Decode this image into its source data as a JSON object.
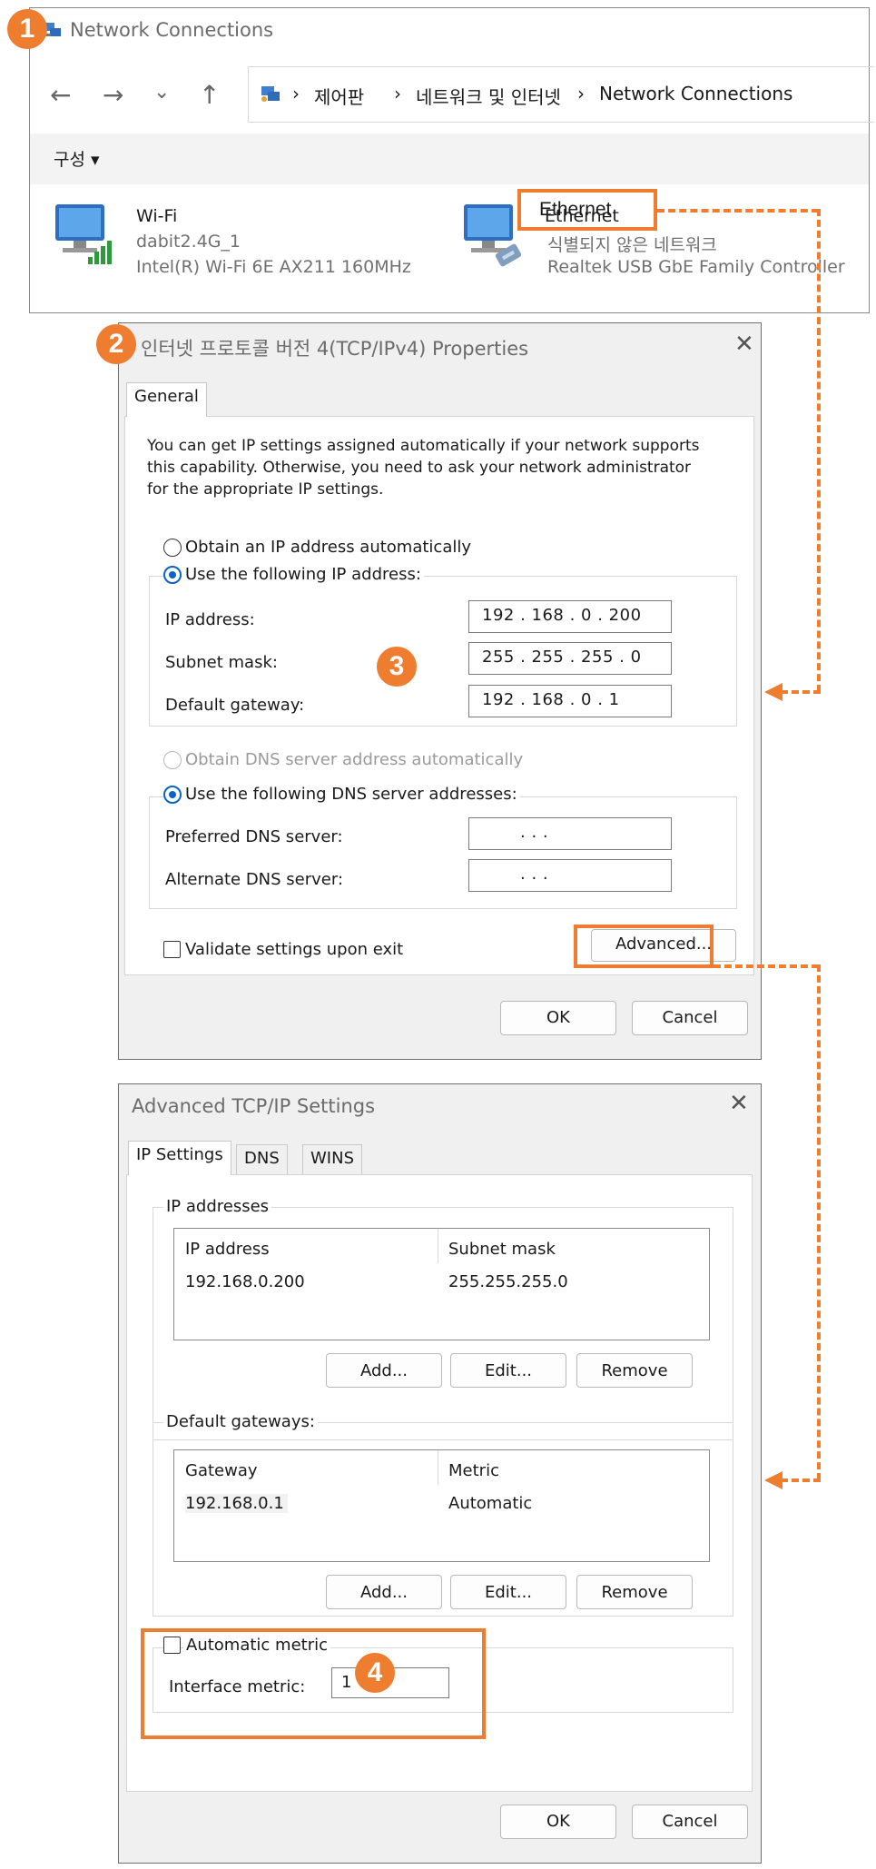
{
  "network_window": {
    "title": "Network Connections",
    "breadcrumb": [
      "제어판",
      "네트워크 및 인터넷",
      "Network Connections"
    ],
    "organize_label": "구성 ▾",
    "adapters": [
      {
        "name": "Wi-Fi",
        "network": "dabit2.4G_1",
        "device": "Intel(R) Wi-Fi 6E AX211 160MHz",
        "icon": "wifi-adapter-icon"
      },
      {
        "name": "Ethernet",
        "network": "식별되지 않은 네트워크",
        "device": "Realtek USB GbE Family Controller",
        "icon": "ethernet-adapter-icon"
      }
    ]
  },
  "ipv4_dialog": {
    "title": "인터넷 프로토콜 버전 4(TCP/IPv4) Properties",
    "tab_general": "General",
    "description": "You can get IP settings assigned automatically if your network supports this capability. Otherwise, you need to ask your network administrator for the appropriate IP settings.",
    "desc_lines": [
      "You can get IP settings assigned automatically if your network supports",
      "this capability. Otherwise, you need to ask your network administrator",
      "for the appropriate IP settings."
    ],
    "radio_obtain_ip": "Obtain an IP address automatically",
    "radio_use_ip": "Use the following IP address:",
    "ip_label": "IP address:",
    "ip_value": "192 . 168 .  0  . 200",
    "subnet_label": "Subnet mask:",
    "subnet_value": "255 . 255 . 255 .  0",
    "gateway_label": "Default gateway:",
    "gateway_value": "192 . 168 .  0  .  1",
    "radio_obtain_dns": "Obtain DNS server address automatically",
    "radio_use_dns": "Use the following DNS server addresses:",
    "pref_dns_label": "Preferred DNS server:",
    "alt_dns_label": "Alternate DNS server:",
    "dns_empty_value": ".       .       .",
    "validate_label": "Validate settings upon exit",
    "advanced_button": "Advanced...",
    "ok_button": "OK",
    "cancel_button": "Cancel"
  },
  "advanced_dialog": {
    "title": "Advanced TCP/IP Settings",
    "tabs": [
      "IP Settings",
      "DNS",
      "WINS"
    ],
    "ip_group_label": "IP addresses",
    "ip_columns": [
      "IP address",
      "Subnet mask"
    ],
    "ip_rows": [
      [
        "192.168.0.200",
        "255.255.255.0"
      ]
    ],
    "gw_group_label": "Default gateways:",
    "gw_columns": [
      "Gateway",
      "Metric"
    ],
    "gw_rows": [
      [
        "192.168.0.1",
        "Automatic"
      ]
    ],
    "add_button": "Add...",
    "edit_button": "Edit...",
    "remove_button": "Remove",
    "auto_metric_label": "Automatic metric",
    "interface_metric_label": "Interface metric:",
    "interface_metric_value": "1",
    "ok_button": "OK",
    "cancel_button": "Cancel"
  },
  "annotations": {
    "steps": [
      "1",
      "2",
      "3",
      "4"
    ],
    "accent_color": "#ef7d2f"
  }
}
